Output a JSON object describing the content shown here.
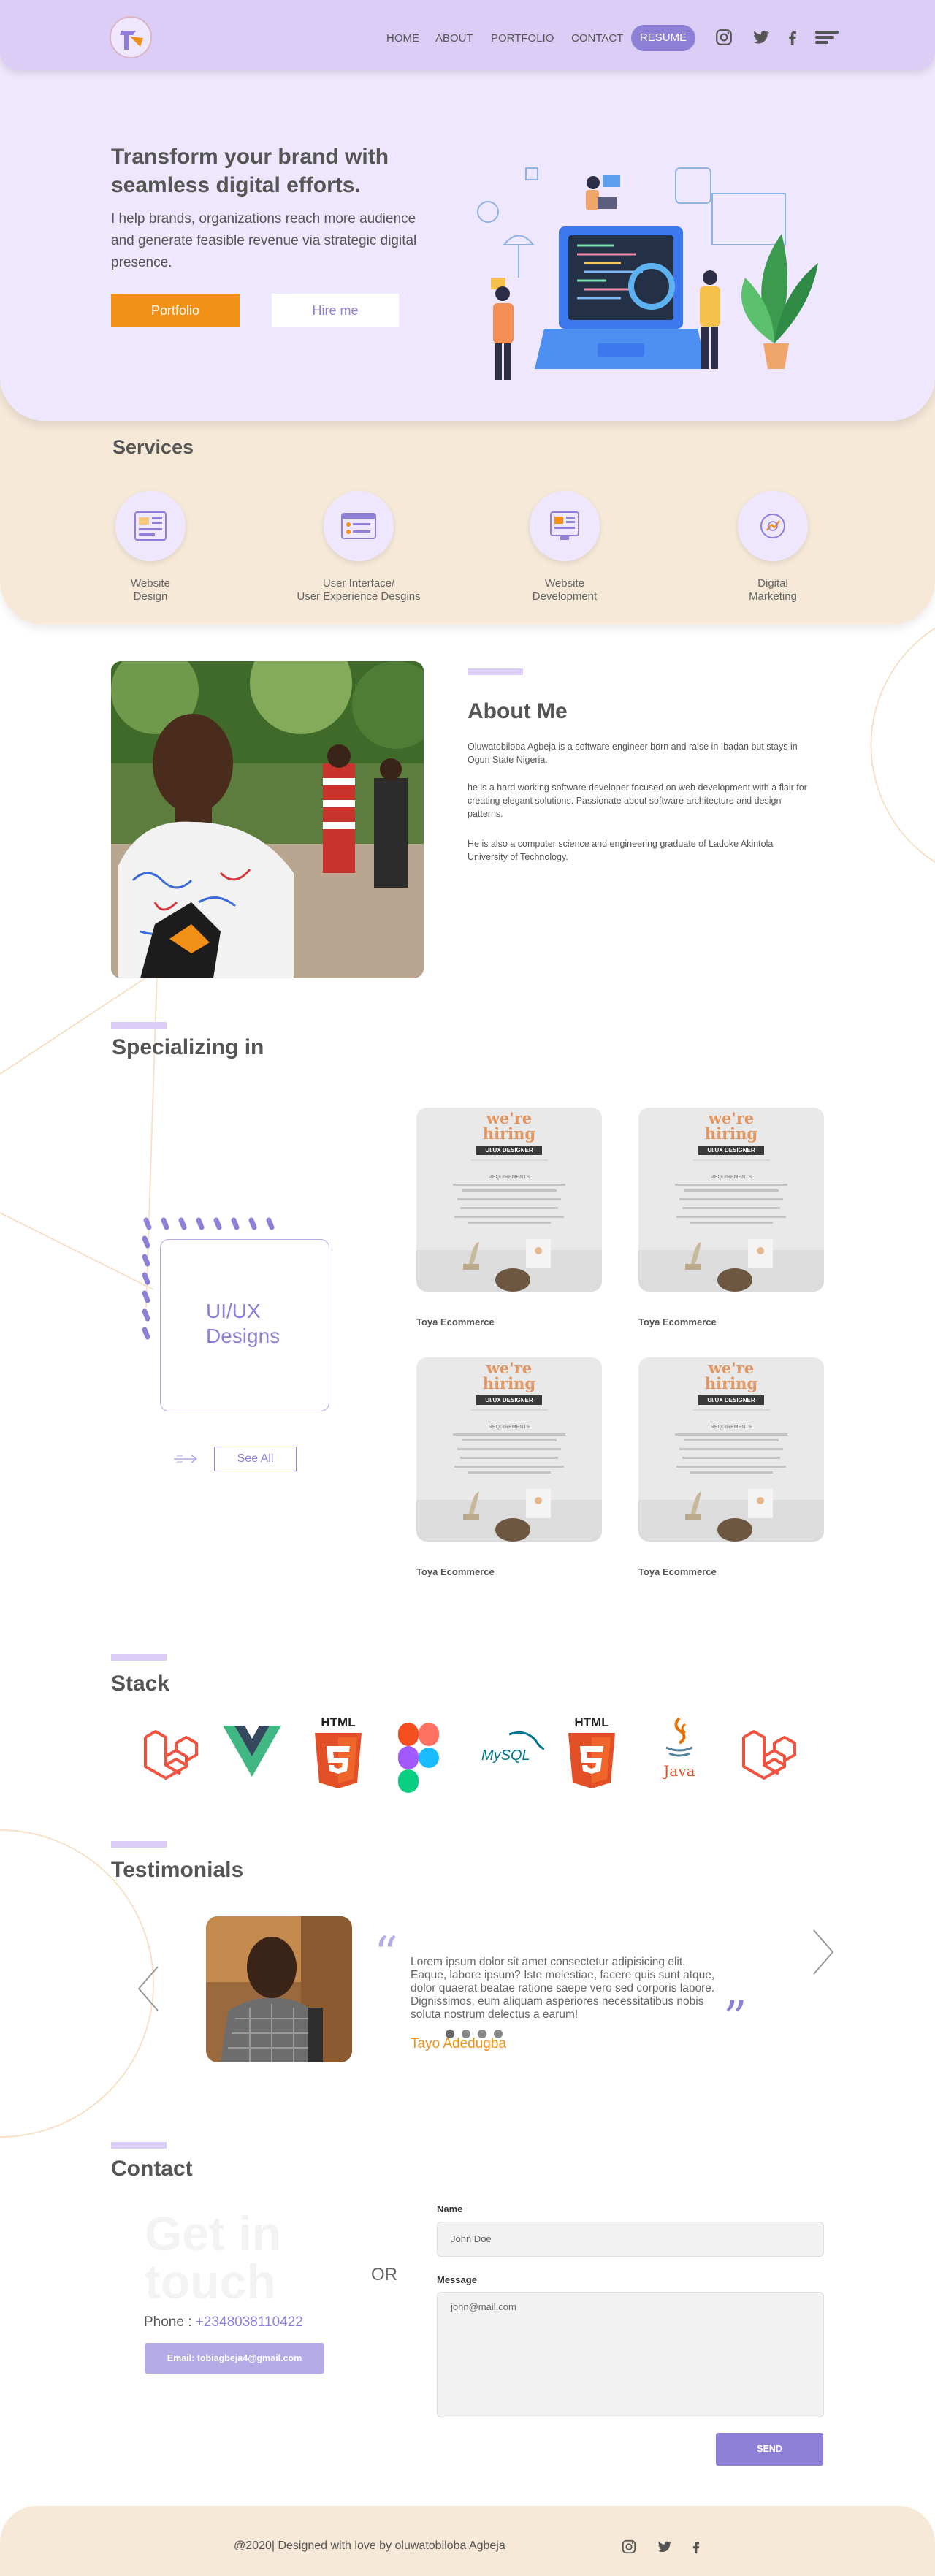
{
  "nav": {
    "items": [
      {
        "label": "HOME"
      },
      {
        "label": "ABOUT"
      },
      {
        "label": "PORTFOLIO"
      },
      {
        "label": "CONTACT"
      }
    ],
    "resume_label": "RESUME",
    "social": [
      "instagram-icon",
      "twitter-icon",
      "facebook-icon"
    ],
    "accent_color": "#8e80d6"
  },
  "hero": {
    "title": "Transform your brand with seamless digital efforts.",
    "subtitle": "I help brands, organizations reach more audience and generate feasible revenue via strategic digital presence.",
    "portfolio_label": "Portfolio",
    "hire_label": "Hire me",
    "cta_color": "#f39018"
  },
  "services": {
    "title": "Services",
    "items": [
      {
        "label": "Website\nDesign"
      },
      {
        "label": "User Interface/\nUser Experience Desgins"
      },
      {
        "label": "Website\nDevelopment"
      },
      {
        "label": "Digital\nMarketing"
      }
    ]
  },
  "about": {
    "title": "About Me",
    "p1": "Oluwatobiloba Agbeja is a software engineer born and raise in Ibadan but stays in Ogun State Nigeria.",
    "p2": "he is a hard working software developer focused on web development with a flair for creating elegant solutions. Passionate about software architecture and design patterns.",
    "p3": "He is also a computer science and engineering graduate of Ladoke Akintola University of Technology."
  },
  "specializing": {
    "title": "Specializing in",
    "card_label": "UI/UX\nDesigns",
    "see_all": "See All",
    "poster": {
      "heading": "we're\nhiring",
      "role": "UI/UX DESIGNER",
      "req": "REQUIREMENTS"
    },
    "projects": [
      {
        "title": "Toya Ecommerce"
      },
      {
        "title": "Toya Ecommerce"
      },
      {
        "title": "Toya Ecommerce"
      },
      {
        "title": "Toya Ecommerce"
      }
    ]
  },
  "stack": {
    "title": "Stack",
    "logos": [
      {
        "name": "laravel-icon",
        "text": ""
      },
      {
        "name": "vue-icon",
        "text": ""
      },
      {
        "name": "html5-icon",
        "text": "HTML"
      },
      {
        "name": "figma-icon",
        "text": ""
      },
      {
        "name": "mysql-icon",
        "text": "MySQL"
      },
      {
        "name": "html5-icon",
        "text": "HTML"
      },
      {
        "name": "java-icon",
        "text": "Java"
      },
      {
        "name": "laravel-icon",
        "text": ""
      }
    ]
  },
  "testimonials": {
    "title": "Testimonials",
    "quote": "Lorem ipsum dolor sit amet consectetur adipisicing elit. Eaque, labore ipsum? Iste molestiae, facere quis sunt atque, dolor quaerat beatae ratione saepe vero sed corporis labore. Dignissimos, eum aliquam asperiores necessitatibus nobis soluta nostrum delectus a earum!",
    "author": "Tayo Adedugba",
    "slides": 4,
    "active_slide": 1
  },
  "contact": {
    "title": "Contact",
    "watermark": "Get in\ntouch",
    "phone_prefix": "Phone : ",
    "phone": "+2348038110422",
    "email_button": "Email: tobiagbeja4@gmail.com",
    "or": "OR",
    "name_label": "Name",
    "name_placeholder": "John Doe",
    "message_label": "Message",
    "message_placeholder": "john@mail.com",
    "send": "SEND"
  },
  "footer": {
    "text": "@2020| Designed with love by oluwatobiloba Agbeja",
    "social": [
      "instagram-icon",
      "twitter-icon",
      "facebook-icon"
    ],
    "background": "#f6e9d8"
  }
}
